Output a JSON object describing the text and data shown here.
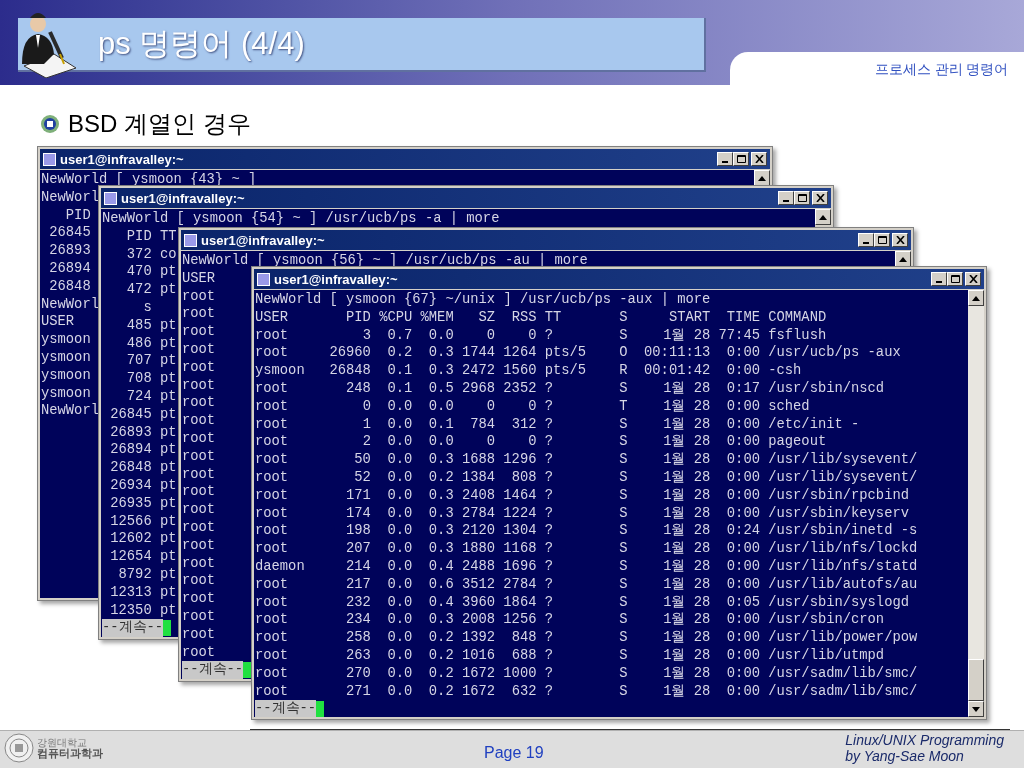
{
  "slide": {
    "title": "ps 명령어 (4/4)",
    "section": "프로세스 관리 명령어",
    "bullet": "BSD 계열인 경우"
  },
  "terminals": [
    {
      "title": "user1@infravalley:~",
      "lines": [
        "NewWorld [ ysmoon {43} ~ ]",
        "NewWorl",
        "   PID",
        " 26845",
        " 26893",
        " 26894",
        " 26848",
        "NewWorl",
        "USER",
        "ysmoon",
        "ysmoon",
        "ysmoon",
        "ysmoon",
        "NewWorl"
      ]
    },
    {
      "title": "user1@infravalley:~",
      "lines": [
        "NewWorld [ ysmoon {54} ~ ] /usr/ucb/ps -a | more",
        "   PID TT",
        "   372 co",
        "   470 pt",
        "   472 pt",
        "     s",
        "   485 pt",
        "   486 pt",
        "   707 pt",
        "   708 pt",
        "   724 pt",
        " 26845 pt",
        " 26893 pt",
        " 26894 pt",
        " 26848 pt",
        " 26934 pt",
        " 26935 pt",
        " 12566 pt",
        " 12602 pt",
        " 12654 pt",
        "  8792 pt",
        " 12313 pt",
        " 12350 pt"
      ],
      "prompt": "--계속--"
    },
    {
      "title": "user1@infravalley:~",
      "lines": [
        "NewWorld [ ysmoon {56} ~ ] /usr/ucb/ps -au | more",
        "USER",
        "root",
        "root",
        "root",
        "root",
        "root",
        "root",
        "root",
        "root",
        "root",
        "root",
        "root",
        "root",
        "root",
        "root",
        "root",
        "root",
        "root",
        "root",
        "root",
        "root",
        "root"
      ],
      "prompt": "--계속--"
    }
  ],
  "main_terminal": {
    "title": "user1@infravalley:~",
    "command_line": "NewWorld [ ysmoon {67} ~/unix ] /usr/ucb/ps -aux | more",
    "columns": [
      "USER",
      "PID",
      "%CPU",
      "%MEM",
      "SZ",
      "RSS",
      "TT",
      "S",
      "START",
      "TIME",
      "COMMAND"
    ],
    "rows": [
      [
        "root",
        "3",
        "0.7",
        "0.0",
        "0",
        "0",
        "?",
        "S",
        "1월 28",
        "77:45",
        "fsflush"
      ],
      [
        "root",
        "26960",
        "0.2",
        "0.3",
        "1744",
        "1264",
        "pts/5",
        "O",
        "00:11:13",
        "0:00",
        "/usr/ucb/ps -aux"
      ],
      [
        "ysmoon",
        "26848",
        "0.1",
        "0.3",
        "2472",
        "1560",
        "pts/5",
        "R",
        "00:01:42",
        "0:00",
        "-csh"
      ],
      [
        "root",
        "248",
        "0.1",
        "0.5",
        "2968",
        "2352",
        "?",
        "S",
        "1월 28",
        "0:17",
        "/usr/sbin/nscd"
      ],
      [
        "root",
        "0",
        "0.0",
        "0.0",
        "0",
        "0",
        "?",
        "T",
        "1월 28",
        "0:00",
        "sched"
      ],
      [
        "root",
        "1",
        "0.0",
        "0.1",
        "784",
        "312",
        "?",
        "S",
        "1월 28",
        "0:00",
        "/etc/init -"
      ],
      [
        "root",
        "2",
        "0.0",
        "0.0",
        "0",
        "0",
        "?",
        "S",
        "1월 28",
        "0:00",
        "pageout"
      ],
      [
        "root",
        "50",
        "0.0",
        "0.3",
        "1688",
        "1296",
        "?",
        "S",
        "1월 28",
        "0:00",
        "/usr/lib/sysevent/"
      ],
      [
        "root",
        "52",
        "0.0",
        "0.2",
        "1384",
        "808",
        "?",
        "S",
        "1월 28",
        "0:00",
        "/usr/lib/sysevent/"
      ],
      [
        "root",
        "171",
        "0.0",
        "0.3",
        "2408",
        "1464",
        "?",
        "S",
        "1월 28",
        "0:00",
        "/usr/sbin/rpcbind"
      ],
      [
        "root",
        "174",
        "0.0",
        "0.3",
        "2784",
        "1224",
        "?",
        "S",
        "1월 28",
        "0:00",
        "/usr/sbin/keyserv"
      ],
      [
        "root",
        "198",
        "0.0",
        "0.3",
        "2120",
        "1304",
        "?",
        "S",
        "1월 28",
        "0:24",
        "/usr/sbin/inetd -s"
      ],
      [
        "root",
        "207",
        "0.0",
        "0.3",
        "1880",
        "1168",
        "?",
        "S",
        "1월 28",
        "0:00",
        "/usr/lib/nfs/lockd"
      ],
      [
        "daemon",
        "214",
        "0.0",
        "0.4",
        "2488",
        "1696",
        "?",
        "S",
        "1월 28",
        "0:00",
        "/usr/lib/nfs/statd"
      ],
      [
        "root",
        "217",
        "0.0",
        "0.6",
        "3512",
        "2784",
        "?",
        "S",
        "1월 28",
        "0:00",
        "/usr/lib/autofs/au"
      ],
      [
        "root",
        "232",
        "0.0",
        "0.4",
        "3960",
        "1864",
        "?",
        "S",
        "1월 28",
        "0:05",
        "/usr/sbin/syslogd"
      ],
      [
        "root",
        "234",
        "0.0",
        "0.3",
        "2008",
        "1256",
        "?",
        "S",
        "1월 28",
        "0:00",
        "/usr/sbin/cron"
      ],
      [
        "root",
        "258",
        "0.0",
        "0.2",
        "1392",
        "848",
        "?",
        "S",
        "1월 28",
        "0:00",
        "/usr/lib/power/pow"
      ],
      [
        "root",
        "263",
        "0.0",
        "0.2",
        "1016",
        "688",
        "?",
        "S",
        "1월 28",
        "0:00",
        "/usr/lib/utmpd"
      ],
      [
        "root",
        "270",
        "0.0",
        "0.2",
        "1672",
        "1000",
        "?",
        "S",
        "1월 28",
        "0:00",
        "/usr/sadm/lib/smc/"
      ],
      [
        "root",
        "271",
        "0.0",
        "0.2",
        "1672",
        "632",
        "?",
        "S",
        "1월 28",
        "0:00",
        "/usr/sadm/lib/smc/"
      ]
    ],
    "prompt": "--계속--"
  },
  "footer": {
    "school": [
      "강원대학교",
      "컴퓨터과학과"
    ],
    "page": "Page 19",
    "course": "Linux/UNIX Programming",
    "author": "by Yang-Sae Moon"
  }
}
